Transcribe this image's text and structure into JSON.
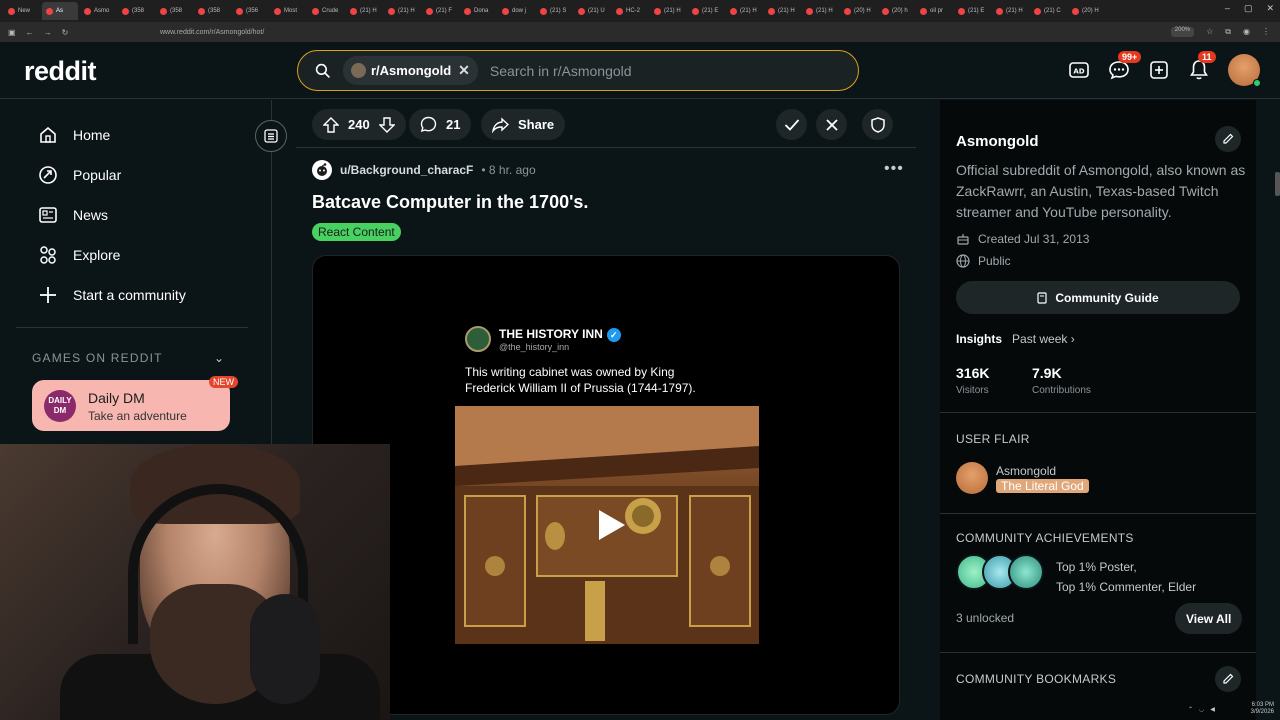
{
  "browser": {
    "tabs": [
      "New",
      "As",
      "Asmo",
      "(358",
      "(358",
      "(358",
      "(356",
      "Most",
      "Crude",
      "(21) H",
      "(21) H",
      "(21) F",
      "Dona",
      "dow j",
      "(21) S",
      "(21) U",
      "HC-2",
      "(21) H",
      "(21) E",
      "(21) H",
      "(21) H",
      "(21) H",
      "(20) H",
      "(20) h",
      "oil pr",
      "(21) E",
      "(21) H",
      "(21) C",
      "(20) H"
    ],
    "url": "www.reddit.com/r/Asmongold/hot/",
    "zoom": "200%"
  },
  "header": {
    "logo": "reddit",
    "search_chip": "r/Asmongold",
    "search_placeholder": "Search in r/Asmongold",
    "chat_badge": "99+",
    "notif_badge": "11"
  },
  "sidebar": {
    "items": [
      {
        "label": "Home",
        "icon": "home-icon"
      },
      {
        "label": "Popular",
        "icon": "popular-icon"
      },
      {
        "label": "News",
        "icon": "news-icon"
      },
      {
        "label": "Explore",
        "icon": "explore-icon"
      },
      {
        "label": "Start a community",
        "icon": "plus-icon"
      }
    ],
    "games_header": "GAMES ON REDDIT",
    "daily": {
      "logo": "DAILY DM",
      "title": "Daily DM",
      "subtitle": "Take an adventure",
      "badge": "NEW"
    }
  },
  "post_actions": {
    "votes": "240",
    "comments": "21",
    "share": "Share"
  },
  "post": {
    "author": "u/Background_characF",
    "age": "• 8 hr. ago",
    "title": "Batcave Computer in the 1700's.",
    "flair": "React Content",
    "tweet": {
      "name": "THE HISTORY INN",
      "handle": "@the_history_inn",
      "text": "This writing cabinet was owned by King Frederick William II of Prussia (1744-1797)."
    }
  },
  "right_panel": {
    "title": "Asmongold",
    "description": "Official subreddit of Asmongold, also known as ZackRawrr, an Austin, Texas-based Twitch streamer and YouTube personality.",
    "created": "Created Jul 31, 2013",
    "visibility": "Public",
    "guide_button": "Community Guide",
    "insights_label": "Insights",
    "insights_period": "Past week",
    "visitors": {
      "value": "316K",
      "label": "Visitors"
    },
    "contributions": {
      "value": "7.9K",
      "label": "Contributions"
    },
    "user_flair_header": "USER FLAIR",
    "flair_user": "Asmongold",
    "flair_tag": "The Literal God",
    "achievements_header": "COMMUNITY ACHIEVEMENTS",
    "achievements_line1": "Top 1% Poster,",
    "achievements_line2": "Top 1% Commenter, Elder",
    "unlocked": "3 unlocked",
    "view_all": "View All",
    "bookmarks_header": "COMMUNITY BOOKMARKS"
  },
  "taskbar": {
    "time": "6:03 PM",
    "date": "3/9/2026"
  },
  "colors": {
    "accent_search": "#d7a21a",
    "flair_green": "#46d160",
    "badge_red": "#e33a1f"
  }
}
